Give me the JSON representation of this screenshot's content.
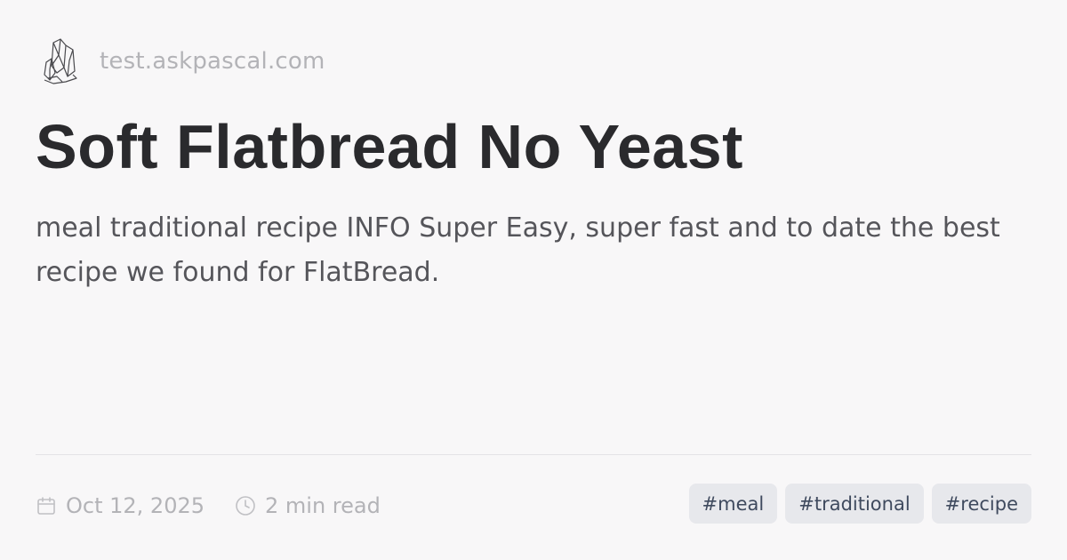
{
  "header": {
    "logo_icon": "crystal-cluster-icon",
    "site": "test.askpascal.com"
  },
  "article": {
    "title": "Soft Flatbread No Yeast",
    "description": "meal traditional recipe INFO Super Easy, super fast and to date the best recipe we found for FlatBread."
  },
  "meta": {
    "date_icon": "calendar-icon",
    "date": "Oct 12, 2025",
    "read_time_icon": "clock-icon",
    "read_time": "2 min read"
  },
  "tags": [
    "#meal",
    "#traditional",
    "#recipe"
  ],
  "colors": {
    "background": "#f8f7f8",
    "title": "#2a2a2d",
    "muted": "#b3b3b7",
    "tag_bg": "#e7e8ec",
    "tag_text": "#3f4a5e"
  }
}
